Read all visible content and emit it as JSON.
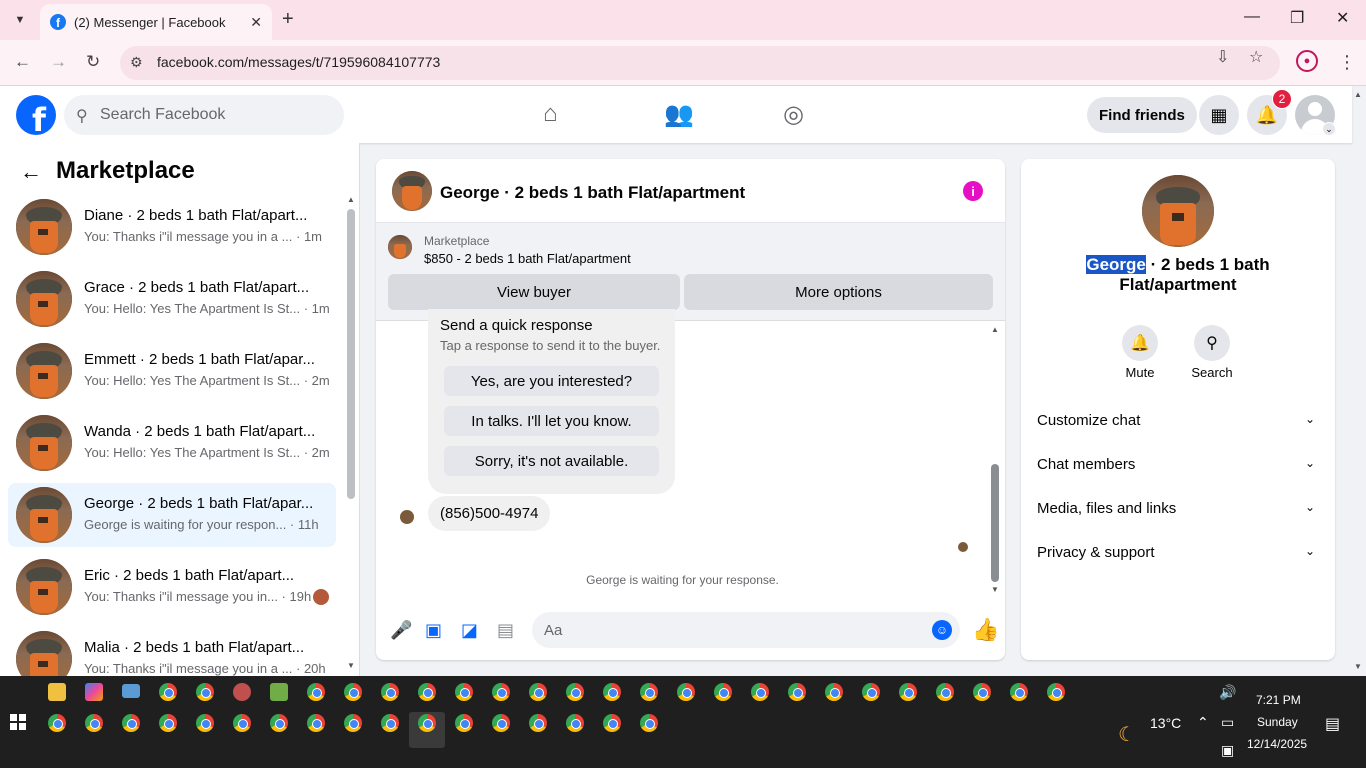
{
  "browser": {
    "tab_title": "(2) Messenger | Facebook",
    "url": "facebook.com/messages/t/719596084107773",
    "new_tab": "+",
    "close": "✕"
  },
  "fb_header": {
    "logo": "f",
    "search_placeholder": "Search Facebook",
    "find_friends": "Find friends",
    "notification_count": "2"
  },
  "sidebar": {
    "title": "Marketplace",
    "conversations": [
      {
        "name": "Diane · 2 beds 1 bath Flat/apart...",
        "preview": "You: Thanks i\"il message you in a ... · 1m"
      },
      {
        "name": "Grace · 2 beds 1 bath Flat/apart...",
        "preview": "You: Hello: Yes The Apartment Is St... · 1m"
      },
      {
        "name": "Emmett · 2 beds 1 bath Flat/apar...",
        "preview": "You: Hello: Yes The Apartment Is St... · 2m"
      },
      {
        "name": "Wanda · 2 beds 1 bath Flat/apart...",
        "preview": "You: Hello: Yes The Apartment Is St... · 2m"
      },
      {
        "name": "George · 2 beds 1 bath Flat/apar...",
        "preview": "George is waiting for your respon... · 11h"
      },
      {
        "name": "Eric · 2 beds 1 bath Flat/apart...",
        "preview": "You: Thanks i\"il message you in... · 19h"
      },
      {
        "name": "Malia · 2 beds 1 bath Flat/apart...",
        "preview": "You: Thanks i\"il message you in a ... · 20h"
      }
    ]
  },
  "chat": {
    "title": "George · 2 beds 1 bath Flat/apartment",
    "marketplace_label": "Marketplace",
    "listing": "$850 - 2 beds 1 bath Flat/apartment",
    "view_buyer": "View buyer",
    "more_options": "More options",
    "quick_response_title": "Send a quick response",
    "quick_response_sub": "Tap a response to send it to the buyer.",
    "quick_options": [
      "Yes, are you interested?",
      "In talks. I'll let you know.",
      "Sorry, it's not available."
    ],
    "phone_message": "(856)500-4974",
    "waiting": "George is waiting for your response.",
    "composer_placeholder": "Aa"
  },
  "info_panel": {
    "name_highlight": "George",
    "name_rest": " · 2 beds 1 bath",
    "name_line2": "Flat/apartment",
    "mute": "Mute",
    "search": "Search",
    "sections": [
      "Customize chat",
      "Chat members",
      "Media, files and links",
      "Privacy & support"
    ]
  },
  "taskbar": {
    "weather": "13°C",
    "time": "7:21 PM",
    "day": "Sunday",
    "date": "12/14/2025"
  },
  "colors": {
    "fb_blue": "#0866ff",
    "tab_pink": "#fbe2ea",
    "info_magenta": "#e60fc3",
    "badge_red": "#e41e3f"
  }
}
